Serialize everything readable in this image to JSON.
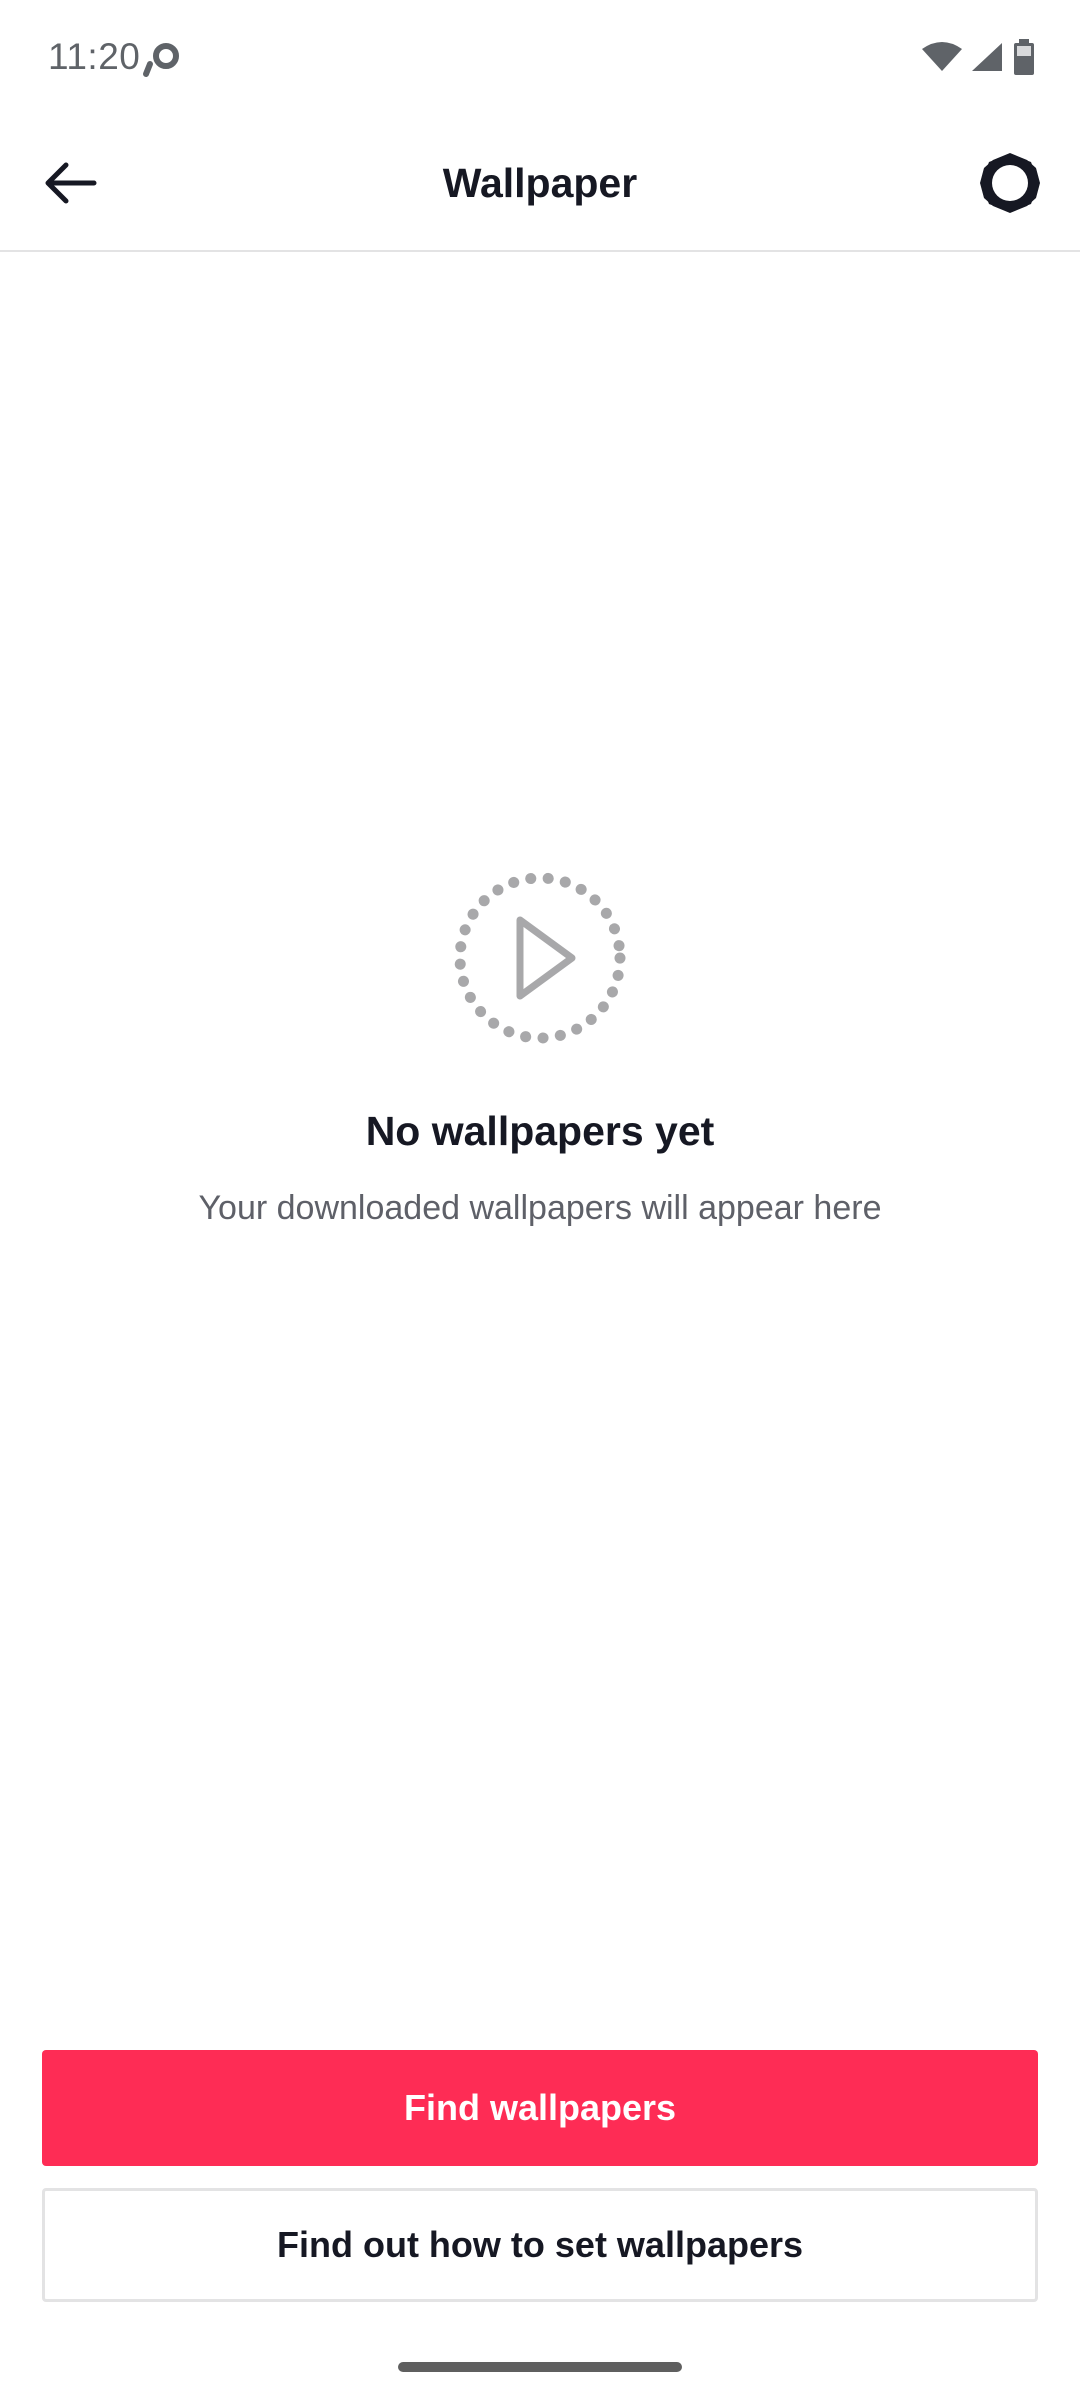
{
  "status_bar": {
    "time": "11:20",
    "icons": [
      "sync-icon",
      "wifi-icon",
      "signal-icon",
      "battery-icon"
    ]
  },
  "header": {
    "title": "Wallpaper",
    "back_icon": "arrow-left-icon",
    "settings_icon": "gear-icon"
  },
  "empty_state": {
    "icon": "play-dotted-circle-icon",
    "title": "No wallpapers yet",
    "subtitle": "Your downloaded wallpapers will appear here"
  },
  "actions": {
    "primary_label": "Find wallpapers",
    "secondary_label": "Find out how to set wallpapers"
  },
  "colors": {
    "accent": "#fe2c55",
    "text_primary": "#161823",
    "text_secondary": "#5e6068",
    "icon_gray": "#a8a8aa",
    "divider": "#e3e3e4"
  }
}
